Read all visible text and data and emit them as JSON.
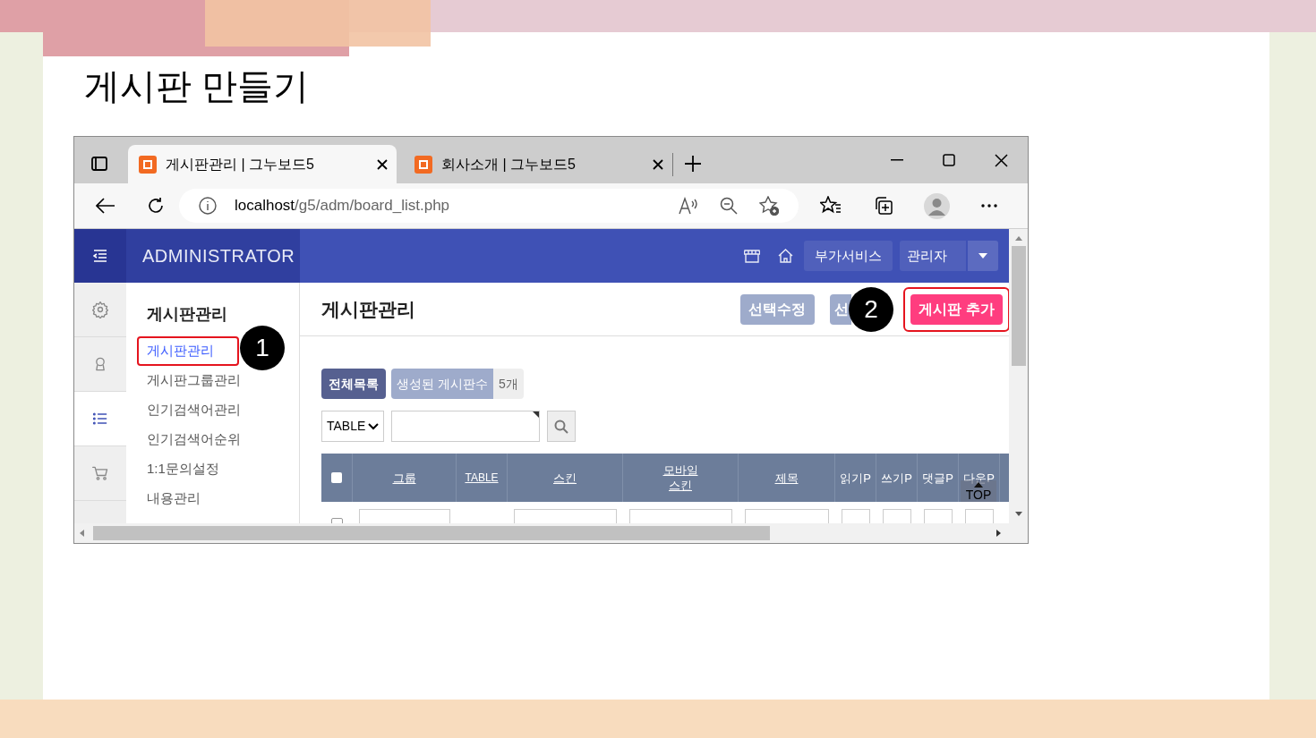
{
  "slide_title": "게시판 만들기",
  "browser": {
    "tabs": [
      {
        "title": "게시판관리 | 그누보드5",
        "selected": true
      },
      {
        "title": "회사소개 | 그누보드5",
        "selected": false
      }
    ],
    "address": {
      "host": "localhost",
      "path": "/g5/adm/board_list.php"
    }
  },
  "admin": {
    "brand": "ADMINISTRATOR",
    "header_buttons": [
      "부가서비스",
      "관리자"
    ],
    "nav_icons": [
      {
        "kind": "gear",
        "selected": false
      },
      {
        "kind": "person",
        "selected": false
      },
      {
        "kind": "list",
        "selected": true
      },
      {
        "kind": "cart",
        "selected": false
      }
    ],
    "submenu": {
      "title": "게시판관리",
      "items": [
        {
          "label": "게시판관리",
          "selected": true,
          "highlighted": true
        },
        {
          "label": "게시판그룹관리",
          "selected": false,
          "highlighted": false
        },
        {
          "label": "인기검색어관리",
          "selected": false,
          "highlighted": false
        },
        {
          "label": "인기검색어순위",
          "selected": false,
          "highlighted": false
        },
        {
          "label": "1:1문의설정",
          "selected": false,
          "highlighted": false
        },
        {
          "label": "내용관리",
          "selected": false,
          "highlighted": false
        }
      ]
    },
    "page_title": "게시판관리",
    "actions": [
      {
        "label": "선택수정",
        "kind": "secondary",
        "highlighted": false
      },
      {
        "label": "선",
        "kind": "secondary",
        "highlighted": false
      },
      {
        "label": "게시판 추가",
        "kind": "primary",
        "highlighted": true
      }
    ],
    "summary": {
      "all": "전체목록",
      "count_label": "생성된 게시판수",
      "count": "5개"
    },
    "search": {
      "select": "TABLE"
    },
    "table": {
      "select_all": {
        "checked": false
      },
      "rows": [
        {
          "checked": false
        }
      ],
      "columns": [
        {
          "label": "그룹",
          "sortable": true
        },
        {
          "label": "TABLE",
          "sortable": true
        },
        {
          "label": "스킨",
          "sortable": true
        },
        {
          "label": "모바일 스킨",
          "sortable": true
        },
        {
          "label": "제목",
          "sortable": true
        },
        {
          "label": "읽기P",
          "sortable": false
        },
        {
          "label": "쓰기P",
          "sortable": false
        },
        {
          "label": "댓글P",
          "sortable": false
        },
        {
          "label": "다운P",
          "sortable": false
        }
      ]
    },
    "top_button": "TOP"
  },
  "callouts": [
    {
      "number": "1"
    },
    {
      "number": "2"
    }
  ]
}
